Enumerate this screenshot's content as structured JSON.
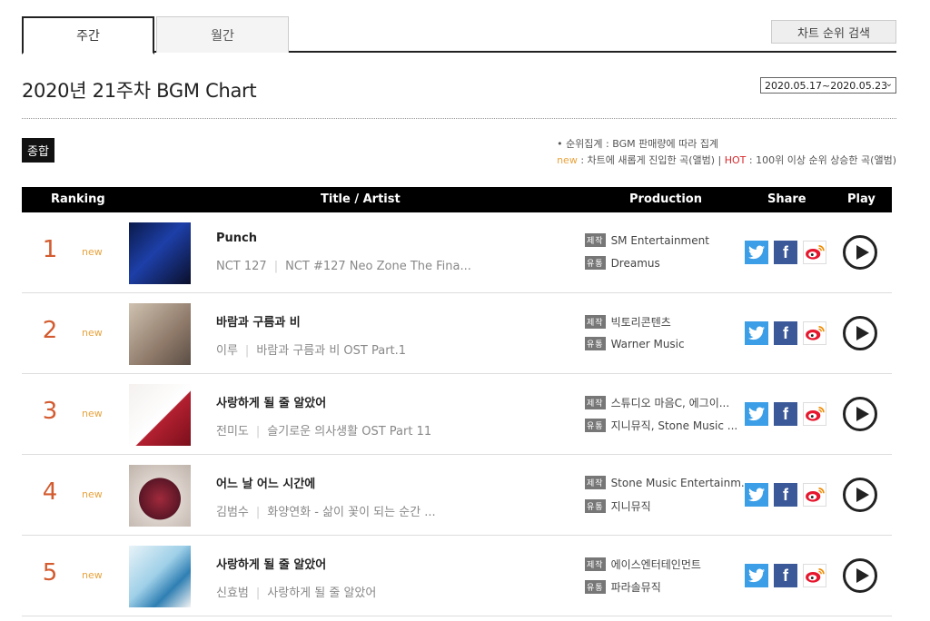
{
  "tabs": {
    "weekly": "주간",
    "monthly": "월간",
    "search": "차트 순위 검색"
  },
  "title": "2020년 21주차 BGM Chart",
  "period": "2020.05.17~2020.05.23",
  "badge": "종합",
  "legend": {
    "line1": "• 순위집계 : BGM 판매량에 따라 집계",
    "new_word": "new",
    "new_desc": " : 차트에 새롭게 진입한 곡(앨범) | ",
    "hot_word": "HOT",
    "hot_desc": " : 100위 이상 순위 상승한 곡(앨범)"
  },
  "headers": {
    "ranking": "Ranking",
    "title_artist": "Title / Artist",
    "production": "Production",
    "share": "Share",
    "play": "Play"
  },
  "production_tags": {
    "maker": "제작",
    "distributor": "유통"
  },
  "rows": [
    {
      "rank": "1",
      "status": "new",
      "title": "Punch",
      "artist": "NCT 127",
      "album": "NCT #127 Neo Zone The Fina...",
      "maker": "SM Entertainment",
      "distributor": "Dreamus"
    },
    {
      "rank": "2",
      "status": "new",
      "title": "바람과 구름과 비",
      "artist": "이루",
      "album": "바람과 구름과 비 OST Part.1",
      "maker": "빅토리콘텐츠",
      "distributor": "Warner Music"
    },
    {
      "rank": "3",
      "status": "new",
      "title": "사랑하게 될 줄 알았어",
      "artist": "전미도",
      "album": "슬기로운 의사생활 OST Part 11",
      "maker": "스튜디오 마음C, 에그이...",
      "distributor": "지니뮤직, Stone Music ..."
    },
    {
      "rank": "4",
      "status": "new",
      "title": "어느 날 어느 시간에",
      "artist": "김범수",
      "album": "화양연화 - 삶이 꽃이 되는 순간 ...",
      "maker": "Stone Music Entertainm...",
      "distributor": "지니뮤직"
    },
    {
      "rank": "5",
      "status": "new",
      "title": "사랑하게 될 줄 알았어",
      "artist": "신효범",
      "album": "사랑하게 될 줄 알았어",
      "maker": "에이스엔터테인먼트",
      "distributor": "파라솔뮤직"
    }
  ],
  "colors": {
    "rank": "#d35b2f",
    "new": "#e8a33d",
    "hot": "#d8282b",
    "twitter": "#3b9ee6",
    "facebook": "#3b5998",
    "weibo": "#e6162d"
  }
}
